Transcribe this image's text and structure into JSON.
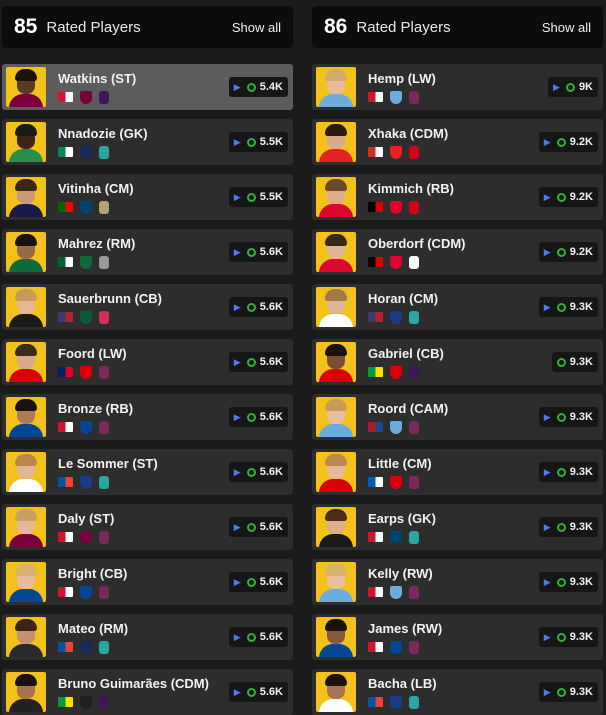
{
  "left": {
    "rating": "85",
    "title": "Rated Players",
    "show_all": "Show all",
    "players": [
      {
        "name": "Watkins (ST)",
        "price": "5.4K",
        "flag": [
          "#cf142b",
          "#ffffff"
        ],
        "crest": "#7a003c",
        "league": "#3d195b",
        "skin": "#5a3a24",
        "hair": "#1c120c",
        "kit": "#7a003c",
        "xbox_only": false,
        "selected": true
      },
      {
        "name": "Nnadozie (GK)",
        "price": "5.5K",
        "flag": [
          "#008751",
          "#ffffff"
        ],
        "crest": "#1b2a5a",
        "league": "#2aa6a0",
        "skin": "#3b2517",
        "hair": "#1a1a1a",
        "kit": "#2a8f4a",
        "xbox_only": false,
        "selected": false
      },
      {
        "name": "Vitinha (CM)",
        "price": "5.5K",
        "flag": [
          "#006600",
          "#ff0000"
        ],
        "crest": "#004170",
        "league": "#b3a26b",
        "skin": "#c99a76",
        "hair": "#3a2616",
        "kit": "#1a1a4a",
        "xbox_only": false,
        "selected": false
      },
      {
        "name": "Mahrez (RM)",
        "price": "5.6K",
        "flag": [
          "#006233",
          "#ffffff"
        ],
        "crest": "#0c6b3a",
        "league": "#9a9a9a",
        "skin": "#9a6a48",
        "hair": "#1a120c",
        "kit": "#0c6b3a",
        "xbox_only": false,
        "selected": false
      },
      {
        "name": "Sauerbrunn (CB)",
        "price": "5.6K",
        "flag": [
          "#3c3b6e",
          "#b22234"
        ],
        "crest": "#0b5b3a",
        "league": "#cf2e5a",
        "skin": "#e8b596",
        "hair": "#c79a5a",
        "kit": "#1a1a1a",
        "xbox_only": false,
        "selected": false
      },
      {
        "name": "Foord (LW)",
        "price": "5.6K",
        "flag": [
          "#012169",
          "#e4002b"
        ],
        "crest": "#db0007",
        "league": "#7a2a5a",
        "skin": "#d8a888",
        "hair": "#3a2a1a",
        "kit": "#db0007",
        "xbox_only": false,
        "selected": false
      },
      {
        "name": "Bronze (RB)",
        "price": "5.6K",
        "flag": [
          "#cf142b",
          "#ffffff"
        ],
        "crest": "#034694",
        "league": "#7a2a5a",
        "skin": "#b07a58",
        "hair": "#1a1212",
        "kit": "#034694",
        "xbox_only": false,
        "selected": false
      },
      {
        "name": "Le Sommer (ST)",
        "price": "5.6K",
        "flag": [
          "#0055a4",
          "#ef4135"
        ],
        "crest": "#1a3a8a",
        "league": "#2aa6a0",
        "skin": "#e2b496",
        "hair": "#b8864a",
        "kit": "#ffffff",
        "xbox_only": false,
        "selected": false
      },
      {
        "name": "Daly (ST)",
        "price": "5.6K",
        "flag": [
          "#cf142b",
          "#ffffff"
        ],
        "crest": "#7a003c",
        "league": "#7a2a5a",
        "skin": "#e4b89a",
        "hair": "#c8a060",
        "kit": "#7a003c",
        "xbox_only": false,
        "selected": false
      },
      {
        "name": "Bright (CB)",
        "price": "5.6K",
        "flag": [
          "#cf142b",
          "#ffffff"
        ],
        "crest": "#034694",
        "league": "#7a2a5a",
        "skin": "#e6bca0",
        "hair": "#d8b070",
        "kit": "#034694",
        "xbox_only": false,
        "selected": false
      },
      {
        "name": "Mateo (RM)",
        "price": "5.6K",
        "flag": [
          "#0055a4",
          "#ef4135"
        ],
        "crest": "#1b2a5a",
        "league": "#2aa6a0",
        "skin": "#c49070",
        "hair": "#3a2416",
        "kit": "#2a2a2a",
        "xbox_only": false,
        "selected": false
      },
      {
        "name": "Bruno Guimarães (CDM)",
        "price": "5.6K",
        "flag": [
          "#009c3b",
          "#ffdf00"
        ],
        "crest": "#241f20",
        "league": "#3d195b",
        "skin": "#a67252",
        "hair": "#1a120c",
        "kit": "#241f20",
        "xbox_only": false,
        "selected": false
      }
    ]
  },
  "right": {
    "rating": "86",
    "title": "Rated Players",
    "show_all": "Show all",
    "players": [
      {
        "name": "Hemp (LW)",
        "price": "9K",
        "flag": [
          "#cf142b",
          "#ffffff"
        ],
        "crest": "#6cabdd",
        "league": "#7a2a5a",
        "skin": "#e6bc9c",
        "hair": "#d4a868",
        "kit": "#6cabdd",
        "xbox_only": false,
        "selected": false
      },
      {
        "name": "Xhaka (CDM)",
        "price": "9.2K",
        "flag": [
          "#d52b1e",
          "#ffffff"
        ],
        "crest": "#e32221",
        "league": "#d20515",
        "skin": "#d8aa88",
        "hair": "#2a1a10",
        "kit": "#e32221",
        "xbox_only": false,
        "selected": false
      },
      {
        "name": "Kimmich (RB)",
        "price": "9.2K",
        "flag": [
          "#000000",
          "#dd0000"
        ],
        "crest": "#dc052d",
        "league": "#d20515",
        "skin": "#dcae8e",
        "hair": "#6a4a2a",
        "kit": "#dc052d",
        "xbox_only": false,
        "selected": false
      },
      {
        "name": "Oberdorf (CDM)",
        "price": "9.2K",
        "flag": [
          "#000000",
          "#dd0000"
        ],
        "crest": "#dc052d",
        "league": "#ffffff",
        "skin": "#e0b496",
        "hair": "#3a2616",
        "kit": "#dc052d",
        "xbox_only": false,
        "selected": false
      },
      {
        "name": "Horan (CM)",
        "price": "9.3K",
        "flag": [
          "#3c3b6e",
          "#b22234"
        ],
        "crest": "#1a3a8a",
        "league": "#2aa6a0",
        "skin": "#e2b496",
        "hair": "#a07a4a",
        "kit": "#ffffff",
        "xbox_only": false,
        "selected": false
      },
      {
        "name": "Gabriel (CB)",
        "price": "9.3K",
        "flag": [
          "#009c3b",
          "#ffdf00"
        ],
        "crest": "#db0007",
        "league": "#3d195b",
        "skin": "#7a4e32",
        "hair": "#1a120c",
        "kit": "#db0007",
        "xbox_only": true,
        "selected": false
      },
      {
        "name": "Roord (CAM)",
        "price": "9.3K",
        "flag": [
          "#ae1c28",
          "#21468b"
        ],
        "crest": "#6cabdd",
        "league": "#7a2a5a",
        "skin": "#e8bea0",
        "hair": "#c89a5a",
        "kit": "#6cabdd",
        "xbox_only": false,
        "selected": false
      },
      {
        "name": "Little (CM)",
        "price": "9.3K",
        "flag": [
          "#005eb8",
          "#ffffff"
        ],
        "crest": "#db0007",
        "league": "#7a2a5a",
        "skin": "#e4b898",
        "hair": "#b88850",
        "kit": "#db0007",
        "xbox_only": false,
        "selected": false
      },
      {
        "name": "Earps (GK)",
        "price": "9.3K",
        "flag": [
          "#cf142b",
          "#ffffff"
        ],
        "crest": "#004170",
        "league": "#2aa6a0",
        "skin": "#dcae8e",
        "hair": "#4a2e1a",
        "kit": "#1a1a1a",
        "xbox_only": false,
        "selected": false
      },
      {
        "name": "Kelly (RW)",
        "price": "9.3K",
        "flag": [
          "#cf142b",
          "#ffffff"
        ],
        "crest": "#6cabdd",
        "league": "#7a2a5a",
        "skin": "#e8c0a2",
        "hair": "#d8b070",
        "kit": "#6cabdd",
        "xbox_only": false,
        "selected": false
      },
      {
        "name": "James (RW)",
        "price": "9.3K",
        "flag": [
          "#cf142b",
          "#ffffff"
        ],
        "crest": "#034694",
        "league": "#7a2a5a",
        "skin": "#8a5a3c",
        "hair": "#1a120c",
        "kit": "#034694",
        "xbox_only": false,
        "selected": false
      },
      {
        "name": "Bacha (LB)",
        "price": "9.3K",
        "flag": [
          "#0055a4",
          "#ef4135"
        ],
        "crest": "#1a3a8a",
        "league": "#2aa6a0",
        "skin": "#a87452",
        "hair": "#1a120c",
        "kit": "#ffffff",
        "xbox_only": false,
        "selected": false
      }
    ]
  },
  "colors": {
    "background": "#1b1b1b",
    "card": "#2d2d2d",
    "card_selected": "#5c5c5c",
    "portrait_bg": "#f2c21b",
    "playstation": "#4a7cf5",
    "xbox": "#34b233"
  }
}
